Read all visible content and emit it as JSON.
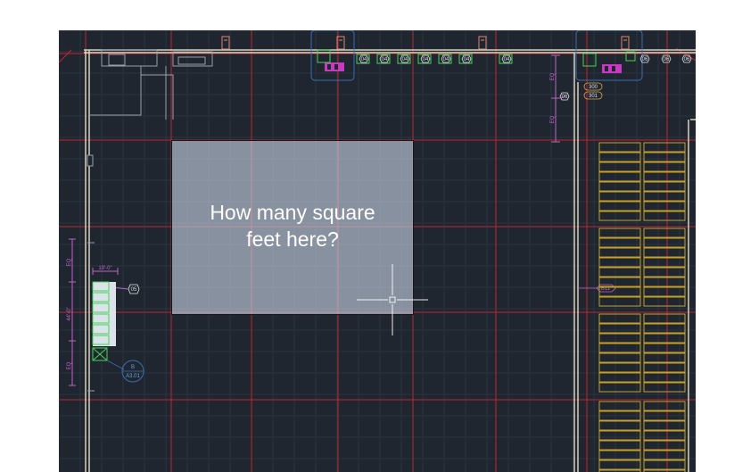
{
  "question": {
    "line1": "How many square",
    "line2": "feet here?"
  },
  "tags": {
    "t04": "04",
    "t05": "05",
    "t06": "06",
    "t300": "300",
    "t301": "301"
  },
  "labels": {
    "dim_top": "19'-0\"",
    "dim_eq": "EQ",
    "dim_side": "44'-0\"",
    "door_tag": "B11",
    "callout_num": "B",
    "callout_sheet": "A3.01"
  },
  "colors": {
    "canvas": "#1f2630",
    "grid": "#2b3440",
    "gridline_red": "#c0262c",
    "wall": "#d9d2bc",
    "fixture": "#44d455",
    "rack": "#c7a22a",
    "dimension": "#c064c8",
    "tag_stroke": "#6fbf8f",
    "selection": "#c8d4e4",
    "crosshair": "#ffffff"
  },
  "cursor": "crosshair"
}
